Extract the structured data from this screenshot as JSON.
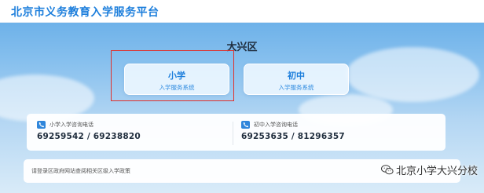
{
  "header": {
    "title": "北京市义务教育入学服务平台"
  },
  "district": {
    "title": "大兴区"
  },
  "buttons": [
    {
      "name": "小学",
      "subtitle": "入学服务系统"
    },
    {
      "name": "初中",
      "subtitle": "入学服务系统"
    }
  ],
  "hotlines": [
    {
      "label": "小学入学咨询电话",
      "number": "69259542 / 69238820",
      "icon": "phone-icon"
    },
    {
      "label": "初中入学咨询电话",
      "number": "69253635 / 81296357",
      "icon": "phone-icon"
    }
  ],
  "notice": {
    "text": "请登录区政府网站查阅相关区级入学政策"
  },
  "watermark": {
    "text": "北京小学大兴分校",
    "icon": "wechat-icon"
  },
  "colors": {
    "accent": "#1e7fdc",
    "highlight": "#e0302b"
  }
}
